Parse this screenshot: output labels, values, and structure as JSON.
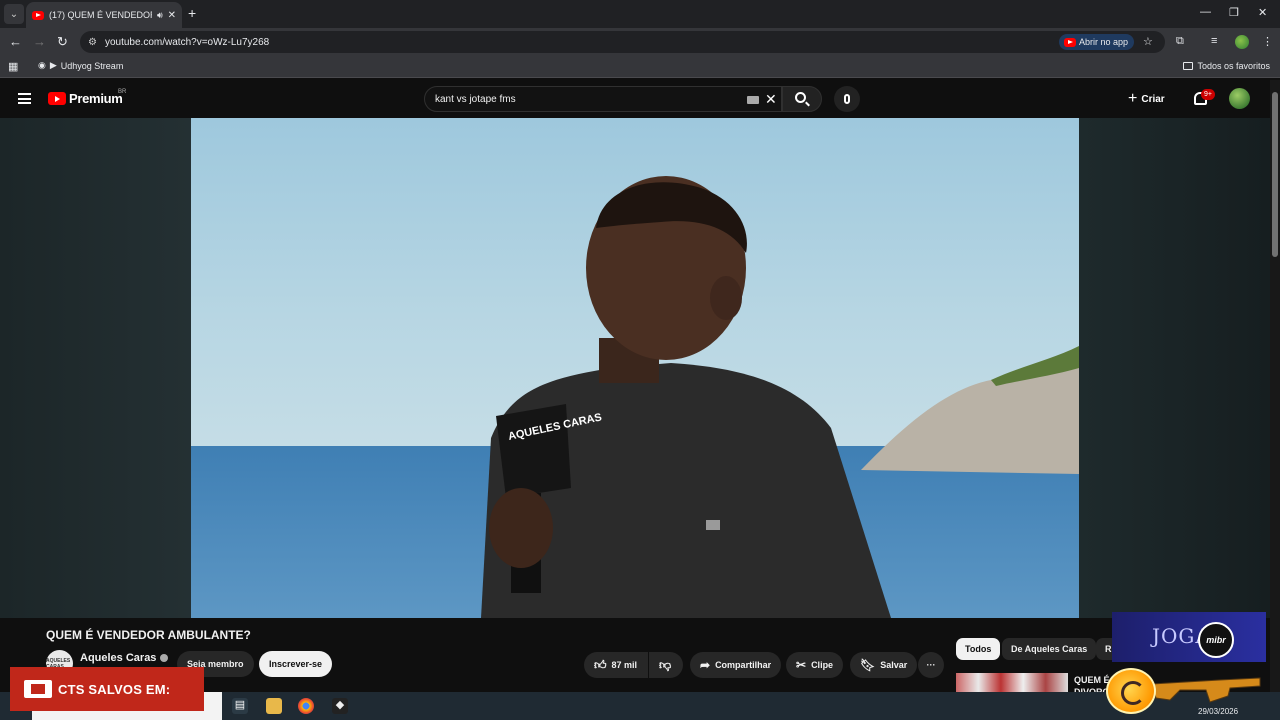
{
  "browser": {
    "tab_title": "(17) QUEM É VENDEDOR AMBULANTE?",
    "url": "youtube.com/watch?v=oWz-Lu7y268",
    "open_app_label": "Abrir no app",
    "bookmark_item": "Udhyog Stream",
    "bookmarks_folder": "Todos os favoritos"
  },
  "header": {
    "logo_text": "Premium",
    "country": "BR",
    "search_value": "kant vs jotape fms",
    "create_label": "Criar",
    "notif_count": "9+"
  },
  "video": {
    "title": "QUEM É VENDEDOR AMBULANTE?",
    "channel": "Aqueles Caras",
    "channel_avatar_text": "AQUELES CARAS",
    "mic_logo": "AQUELES CARAS",
    "join_label": "Seja membro",
    "subscribe_label": "Inscrever-se",
    "likes": "87 mil",
    "share_label": "Compartilhar",
    "clip_label": "Clipe",
    "save_label": "Salvar",
    "more_label": "···"
  },
  "sidebar": {
    "chips": [
      "Todos",
      "De Aqueles Caras",
      "R"
    ],
    "rec_title_line1": "QUEM É C",
    "rec_title_line2": "DIVORCI"
  },
  "overlays": {
    "promo_text": "CTS SALVOS EM:",
    "mibr_text": "JOGA",
    "mibr_logo": "mibr"
  },
  "taskbar": {
    "date": "29/03/2026"
  },
  "colors": {
    "yt_red": "#ff0000",
    "background": "#0f0f0f",
    "promo_red": "#c0271a"
  }
}
